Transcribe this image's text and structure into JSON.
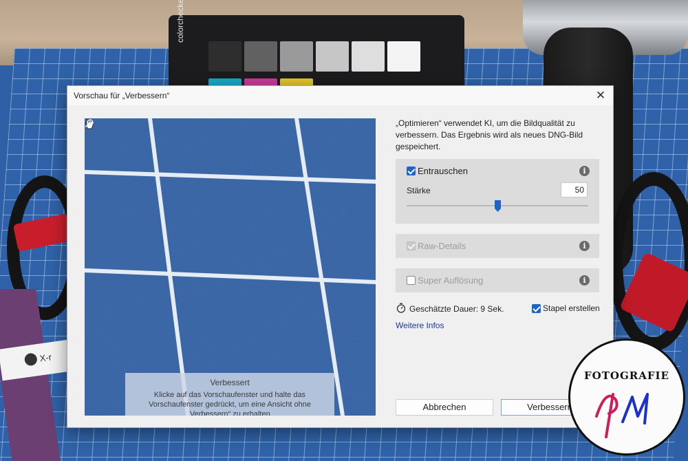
{
  "dialog": {
    "title": "Vorschau für „Verbessern“",
    "close_label": "✕",
    "description": "„Optimieren“ verwendet KI, um die Bildqualität zu verbessern. Das Ergebnis wird als neues DNG-Bild gespeichert."
  },
  "preview": {
    "overlay_title": "Verbessert",
    "overlay_text": "Klicke auf das Vorschaufenster und halte das Vorschaufenster gedrückt, um eine Ansicht ohne „Verbessern“ zu erhalten."
  },
  "denoise": {
    "label": "Entrauschen",
    "checked": true,
    "strength_label": "Stärke",
    "strength_value": "50",
    "strength_fraction": 0.5
  },
  "raw_details": {
    "label": "Raw-Details",
    "checked": true,
    "enabled": false
  },
  "super_resolution": {
    "label": "Super Auflösung",
    "checked": false
  },
  "footer": {
    "duration": "Geschätzte Dauer: 9 Sek.",
    "stack_label": "Stapel erstellen",
    "stack_checked": true,
    "more_info": "Weitere Infos",
    "cancel_label": "Abbrechen",
    "enhance_label": "Verbessern"
  },
  "background": {
    "checker_brand": "colorchecker",
    "ribbon_text": "X-r",
    "watermark_text": "FOTOGRAFIE",
    "watermark_script": "PM"
  },
  "colors": {
    "accent": "#1e65c9",
    "link": "#1a36a8",
    "mat_blue": "#2f62a8"
  }
}
